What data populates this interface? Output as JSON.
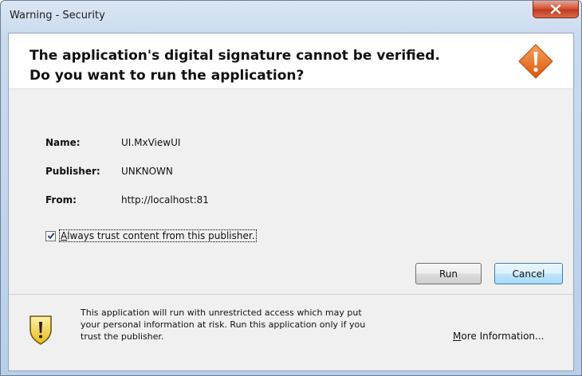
{
  "window": {
    "title": "Warning - Security",
    "close_glyph": "X"
  },
  "header": {
    "line1": "The application's digital signature cannot be verified.",
    "line2": "Do you want to run the application?"
  },
  "details": [
    {
      "label": "Name:",
      "value": "UI.MxViewUI"
    },
    {
      "label": "Publisher:",
      "value": "UNKNOWN"
    },
    {
      "label": "From:",
      "value": "http://localhost:81"
    }
  ],
  "trust_checkbox": {
    "checked": true,
    "label_first": "A",
    "label_rest": "lways trust content from this publisher."
  },
  "buttons": {
    "run": "Run",
    "cancel": "Cancel"
  },
  "footer": {
    "line1": "This application will run with unrestricted access which may put",
    "line2": "your personal information at risk. Run this application only if you",
    "line3": "trust the publisher.",
    "more_info_first": "M",
    "more_info_rest": "ore Information..."
  },
  "colors": {
    "warning_orange": "#e8731e",
    "shield_yellow": "#f2d33a",
    "cancel_focus_border": "#3c7fb1"
  },
  "icons": {
    "header": "warning-diamond-icon",
    "footer": "warning-shield-icon",
    "close": "close-icon",
    "checkbox": "checkmark-icon"
  }
}
